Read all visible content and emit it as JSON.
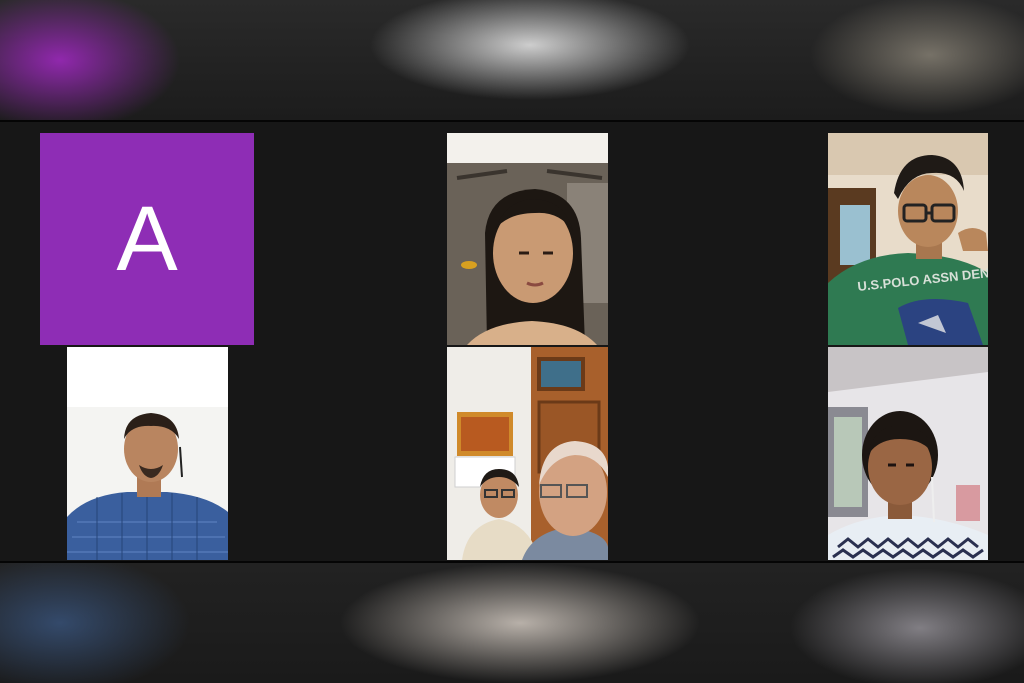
{
  "avatar": {
    "initial": "A",
    "color": "#8e2db5"
  },
  "participants": [
    {
      "tile": "avatar",
      "initial": "A"
    },
    {
      "tile": "video",
      "description_icon": "person-video-icon"
    },
    {
      "tile": "video",
      "description_icon": "person-video-icon"
    },
    {
      "tile": "video",
      "description_icon": "person-video-icon"
    },
    {
      "tile": "video",
      "description_icon": "person-video-icon"
    },
    {
      "tile": "video",
      "description_icon": "person-video-icon"
    }
  ],
  "shirt_text": "U.S.POLO ASSN DENIM CO",
  "colors": {
    "background": "#171717",
    "avatar_bg": "#8e2db5",
    "avatar_text": "#ffffff"
  }
}
